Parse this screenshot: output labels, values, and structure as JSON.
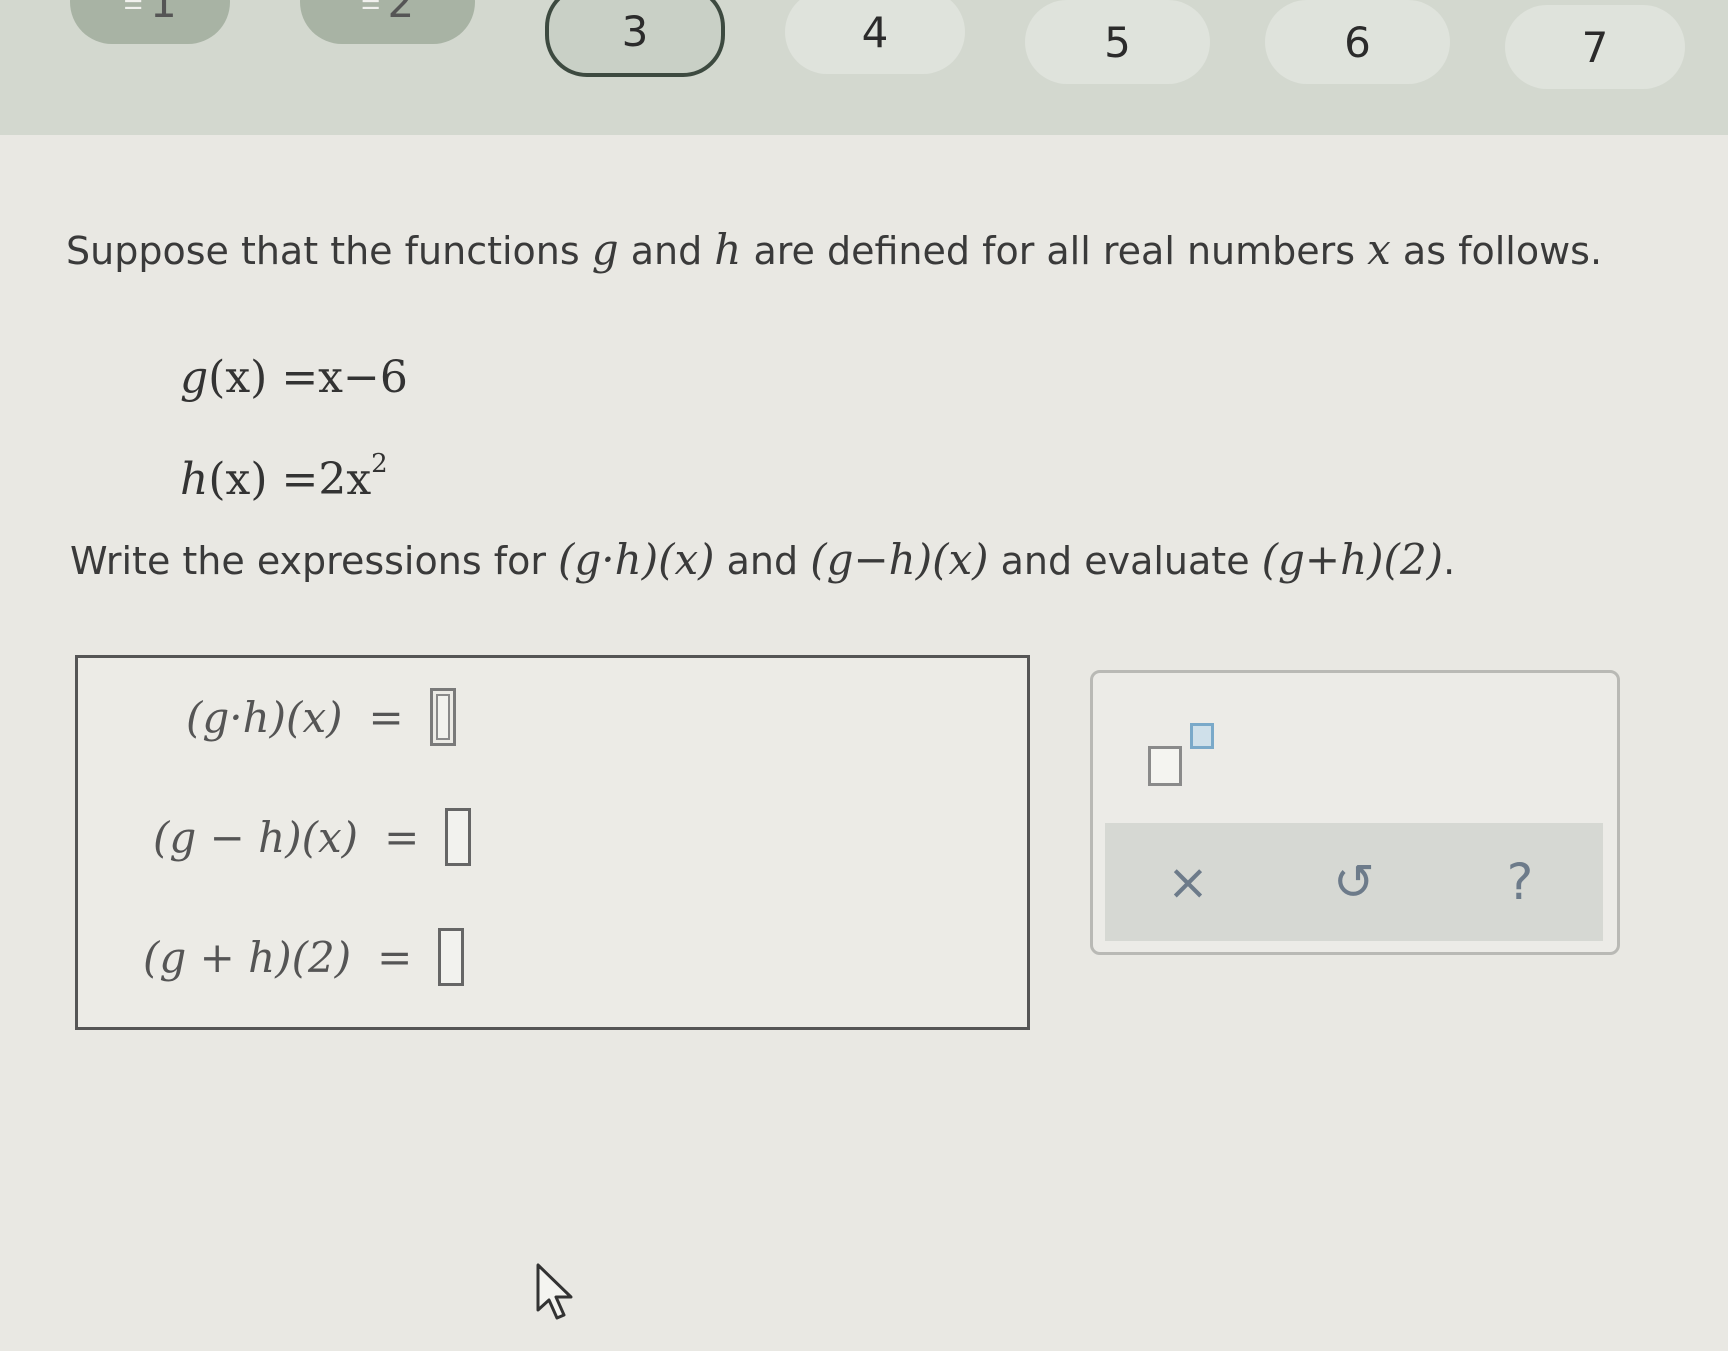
{
  "nav": {
    "steps": [
      {
        "label": "1",
        "state": "done"
      },
      {
        "label": "2",
        "state": "done"
      },
      {
        "label": "3",
        "state": "current"
      },
      {
        "label": "4",
        "state": "todo"
      },
      {
        "label": "5",
        "state": "todo"
      },
      {
        "label": "6",
        "state": "todo"
      },
      {
        "label": "7",
        "state": "todo"
      }
    ]
  },
  "question": {
    "prompt_start": "Suppose that the functions ",
    "var_g": "g",
    "word_and": " and ",
    "var_h": "h",
    "prompt_mid": " are defined for all real numbers ",
    "var_x": "x",
    "prompt_end": " as follows.",
    "g_def_lhs": "g",
    "g_def_arg": "(x)",
    "g_def_rhs": " =x−6",
    "h_def_lhs": "h",
    "h_def_arg": "(x)",
    "h_def_rhs": " =2x",
    "h_def_exp": "2",
    "instr_start": "Write the expressions for ",
    "expr_product": "(g·h)(x)",
    "instr_and": " and ",
    "expr_difference": "(g−h)(x)",
    "instr_evaluate": " and evaluate ",
    "expr_sum_at_2": "(g+h)(2)",
    "instr_end": "."
  },
  "answers": [
    {
      "lhs": "(g·h)(x)",
      "eq": "=",
      "value": ""
    },
    {
      "lhs": "(g − h)(x)",
      "eq": "=",
      "value": ""
    },
    {
      "lhs": "(g + h)(2)",
      "eq": "=",
      "value": ""
    }
  ],
  "palette": {
    "clear_symbol": "×",
    "undo_symbol": "↺",
    "help_symbol": "?"
  },
  "colors": {
    "nav_done": "#a8b3a4",
    "nav_current_border": "#3d4a40",
    "power_slot": "#7aa9c9",
    "action_icons": "#6d7b8a"
  }
}
